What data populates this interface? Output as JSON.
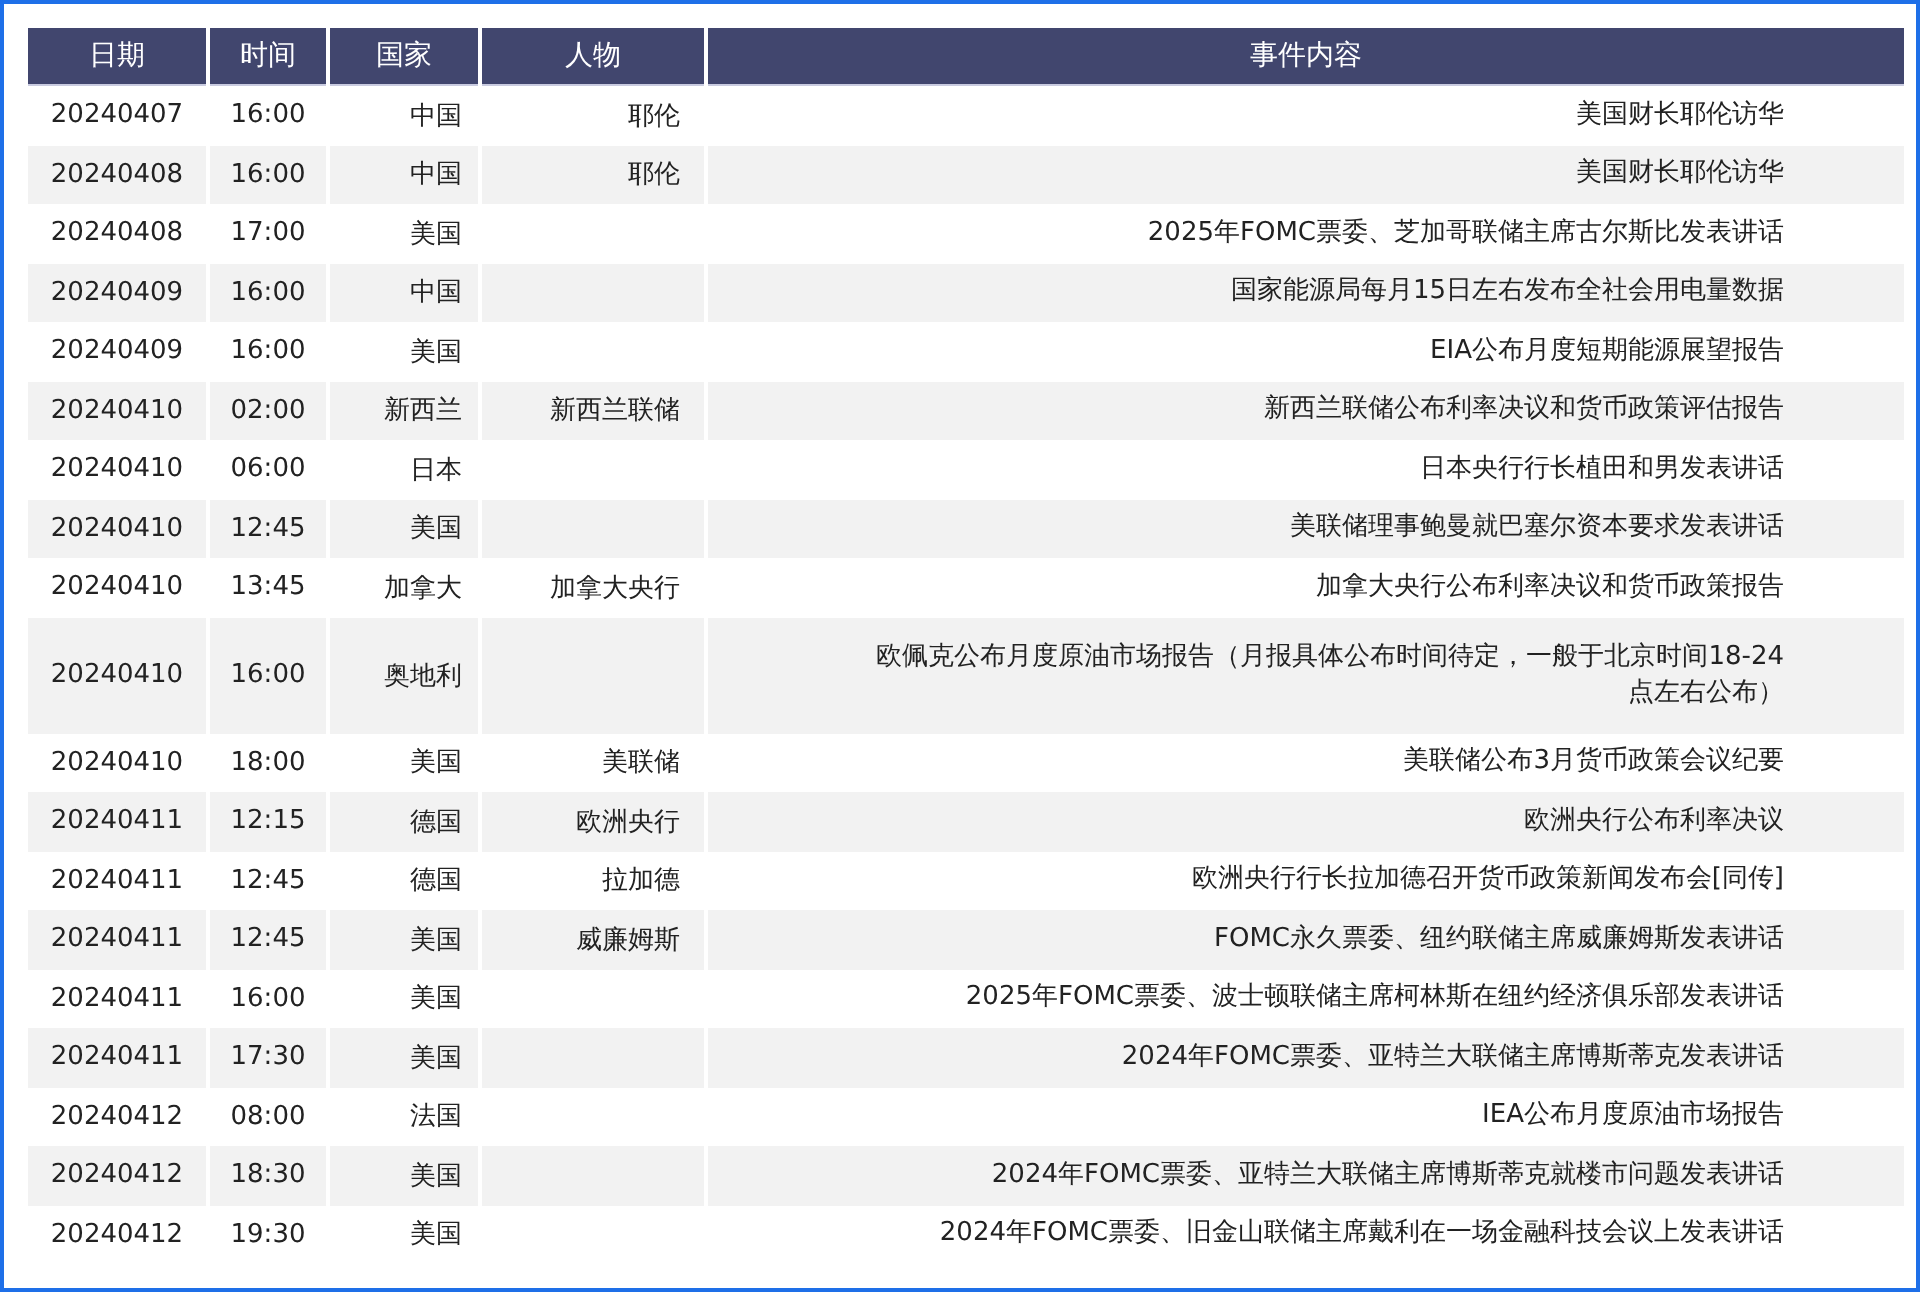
{
  "table": {
    "columns": [
      "日期",
      "时间",
      "国家",
      "人物",
      "事件内容"
    ],
    "rows": [
      {
        "date": "20240407",
        "time": "16:00",
        "country": "中国",
        "person": "耶伦",
        "event": "美国财长耶伦访华"
      },
      {
        "date": "20240408",
        "time": "16:00",
        "country": "中国",
        "person": "耶伦",
        "event": "美国财长耶伦访华"
      },
      {
        "date": "20240408",
        "time": "17:00",
        "country": "美国",
        "event": "2025年FOMC票委、芝加哥联储主席古尔斯比发表讲话"
      },
      {
        "date": "20240409",
        "time": "16:00",
        "country": "中国",
        "event": "国家能源局每月15日左右发布全社会用电量数据"
      },
      {
        "date": "20240409",
        "time": "16:00",
        "country": "美国",
        "event": "EIA公布月度短期能源展望报告"
      },
      {
        "date": "20240410",
        "time": "02:00",
        "country": "新西兰",
        "person": "新西兰联储",
        "event": "新西兰联储公布利率决议和货币政策评估报告"
      },
      {
        "date": "20240410",
        "time": "06:00",
        "country": "日本",
        "event": "日本央行行长植田和男发表讲话"
      },
      {
        "date": "20240410",
        "time": "12:45",
        "country": "美国",
        "event": "美联储理事鲍曼就巴塞尔资本要求发表讲话"
      },
      {
        "date": "20240410",
        "time": "13:45",
        "country": "加拿大",
        "person": "加拿大央行",
        "event": "加拿大央行公布利率决议和货币政策报告"
      },
      {
        "date": "20240410",
        "time": "16:00",
        "country": "奥地利",
        "event": "欧佩克公布月度原油市场报告（月报具体公布时间待定，一般于北京时间18-24点左右公布）"
      },
      {
        "date": "20240410",
        "time": "18:00",
        "country": "美国",
        "person": "美联储",
        "event": "美联储公布3月货币政策会议纪要"
      },
      {
        "date": "20240411",
        "time": "12:15",
        "country": "德国",
        "person": "欧洲央行",
        "event": "欧洲央行公布利率决议"
      },
      {
        "date": "20240411",
        "time": "12:45",
        "country": "德国",
        "person": "拉加德",
        "event": "欧洲央行行长拉加德召开货币政策新闻发布会[同传]"
      },
      {
        "date": "20240411",
        "time": "12:45",
        "country": "美国",
        "person": "威廉姆斯",
        "event": "FOMC永久票委、纽约联储主席威廉姆斯发表讲话"
      },
      {
        "date": "20240411",
        "time": "16:00",
        "country": "美国",
        "event": "2025年FOMC票委、波士顿联储主席柯林斯在纽约经济俱乐部发表讲话"
      },
      {
        "date": "20240411",
        "time": "17:30",
        "country": "美国",
        "event": "2024年FOMC票委、亚特兰大联储主席博斯蒂克发表讲话"
      },
      {
        "date": "20240412",
        "time": "08:00",
        "country": "法国",
        "event": "IEA公布月度原油市场报告"
      },
      {
        "date": "20240412",
        "time": "18:30",
        "country": "美国",
        "event": "2024年FOMC票委、亚特兰大联储主席博斯蒂克就楼市问题发表讲话"
      },
      {
        "date": "20240412",
        "time": "19:30",
        "country": "美国",
        "event": "2024年FOMC票委、旧金山联储主席戴利在一场金融科技会议上发表讲话"
      }
    ]
  }
}
